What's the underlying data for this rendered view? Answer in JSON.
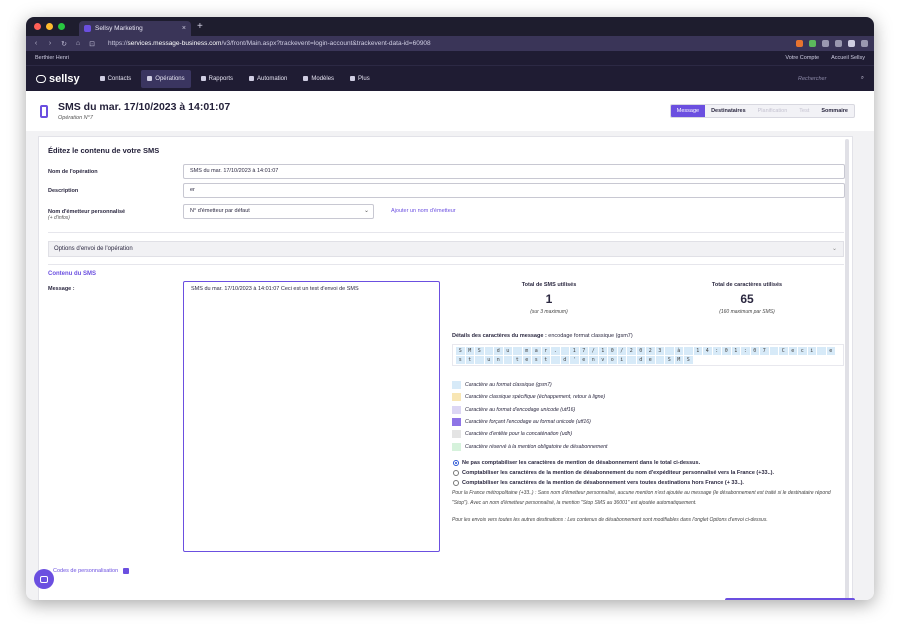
{
  "browser": {
    "tab_title": "Sellsy Marketing",
    "tab_close": "×",
    "new_tab": "+",
    "url_prefix": "https://",
    "url_domain": "services.message-business.com",
    "url_path": "/v3/front/Main.aspx?trackevent=login-account&trackevent-data-id=60908",
    "nav": [
      "‹",
      "›",
      "↻",
      "⌂",
      "⊡"
    ]
  },
  "topbar": {
    "user": "Berthier Henri",
    "account": "Votre Compte",
    "sellsy_account": "Accueil Sellsy"
  },
  "nav": {
    "logo": "sellsy",
    "items": [
      {
        "label": "Contacts",
        "active": false
      },
      {
        "label": "Opérations",
        "active": true
      },
      {
        "label": "Rapports",
        "active": false
      },
      {
        "label": "Automation",
        "active": false
      },
      {
        "label": "Modèles",
        "active": false
      },
      {
        "label": "Plus",
        "active": false
      }
    ],
    "search_placeholder": "Rechercher",
    "search_icon": "⌕"
  },
  "header": {
    "title": "SMS du mar. 17/10/2023 à 14:01:07",
    "subtitle": "Opération N°7",
    "steps": [
      {
        "label": "Message",
        "state": "active"
      },
      {
        "label": "Destinataires",
        "state": "normal"
      },
      {
        "label": "Planification",
        "state": "disabled"
      },
      {
        "label": "Test",
        "state": "disabled"
      },
      {
        "label": "Sommaire",
        "state": "normal"
      }
    ]
  },
  "form": {
    "card_title": "Éditez le contenu de votre SMS",
    "name_label": "Nom de l'opération",
    "name_value": "SMS du mar. 17/10/2023 à 14:01:07",
    "description_label": "Description",
    "description_value": "er",
    "sender_label": "Nom d'émetteur personnalisé",
    "sender_hint": "(+ d'infos)",
    "sender_value": "N° d'émetteur par défaut",
    "sender_arrow": "⌄",
    "add_sender_link": "Ajouter un nom d'émetteur",
    "options_label": "Options d'envoi de l'opération",
    "options_chevron": "⌄"
  },
  "sms": {
    "section_title": "Contenu du SMS",
    "message_label": "Message :",
    "message_value": "SMS du mar. 17/10/2023 à 14:01:07 Ceci est un test d'envoi de SMS",
    "stats": {
      "sms_title": "Total de SMS utilisés",
      "sms_value": "1",
      "sms_note": "(sur 3 maximum)",
      "chars_title": "Total de caractères utilisés",
      "chars_value": "65",
      "chars_note": "(160 maximum par SMS)"
    },
    "details_title": "Détails des caractères du message :",
    "details_encoding": " encodage format classique (gsm7)",
    "char_cells": [
      "S",
      "M",
      "S",
      " ",
      "d",
      "u",
      " ",
      "m",
      "a",
      "r",
      ".",
      " ",
      "1",
      "7",
      "/",
      "1",
      "0",
      "/",
      "2",
      "0",
      "2",
      "3",
      " ",
      "à",
      " ",
      "1",
      "4",
      ":",
      "0",
      "1",
      ":",
      "0",
      "7",
      " ",
      "C",
      "e",
      "c",
      "i",
      " ",
      "e",
      "s",
      "t",
      " ",
      "u",
      "n",
      " ",
      "t",
      "e",
      "s",
      "t",
      " ",
      "d",
      "'",
      "e",
      "n",
      "v",
      "o",
      "i",
      " ",
      "d",
      "e",
      " ",
      "S",
      "M",
      "S"
    ],
    "legend": [
      {
        "label": "Caractère au format classique (gsm7)",
        "color": "#d7eaf8"
      },
      {
        "label": "Caractère classique spécifique (échappement, retour à ligne)",
        "color": "#f8e6b4"
      },
      {
        "label": "Caractère au format d'encodage unicode (utf16)",
        "color": "#dcd6f4"
      },
      {
        "label": "Caractère forçant l'encodage au format unicode (utf16)",
        "color": "#8e74e6"
      },
      {
        "label": "Caractère d'entête pour la concaténation (udh)",
        "color": "#e4e4e4"
      },
      {
        "label": "Caractère réservé à la mention obligatoire de désabonnement",
        "color": "#d6f2dc"
      }
    ],
    "radios": [
      {
        "label": "Ne pas comptabiliser les caractères de mention de désabonnement dans le total ci-dessus.",
        "checked": true
      },
      {
        "label": "Comptabiliser les caractères de la mention de désabonnement du nom d'expéditeur personnalisé vers la France (+33..).",
        "checked": false
      },
      {
        "label": "Comptabiliser les caractères de la mention de désabonnement vers toutes destinations hors France (+ 33..).",
        "checked": false
      }
    ],
    "note_france": "Pour la France métropolitaine (+33..) : Sans nom d'émetteur personnalisé, aucune mention n'est ajoutée au message (le désabonnement est traité si le destinataire répond \"Stop\"). Avec un nom d'émetteur personnalisé, la mention \"Stop SMS au 36001\" est ajoutée automatiquement.",
    "note_other": "Pour les envois vers toutes les autres destinations : Les contenus de désabonnement sont modifiables dans l'onglet Options d'envoi ci-dessus.",
    "codes_link": "Codes de personnalisation"
  },
  "colors": {
    "accent": "#6b4fe0",
    "topbar": "#1f1c33"
  }
}
